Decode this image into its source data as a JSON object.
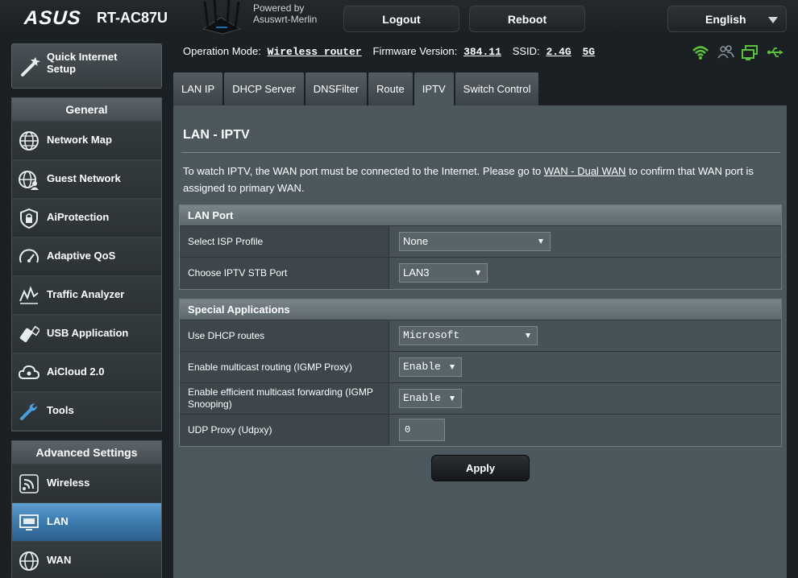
{
  "header": {
    "brand": "ASUS",
    "model": "RT-AC87U",
    "powered_by_line1": "Powered by",
    "powered_by_line2": "Asuswrt-Merlin",
    "logout_label": "Logout",
    "reboot_label": "Reboot",
    "language": "English"
  },
  "status": {
    "operation_mode_label": "Operation Mode:",
    "operation_mode_value": "Wireless router",
    "firmware_label": "Firmware Version:",
    "firmware_value": "384.11",
    "ssid_label": "SSID:",
    "ssid_24": "2.4G",
    "ssid_5": "5G",
    "icons": [
      "wifi-icon",
      "users-icon",
      "network-icon",
      "usb-icon"
    ]
  },
  "sidebar": {
    "quick_setup_line1": "Quick Internet",
    "quick_setup_line2": "Setup",
    "general_title": "General",
    "general_items": [
      {
        "label": "Network Map"
      },
      {
        "label": "Guest Network"
      },
      {
        "label": "AiProtection"
      },
      {
        "label": "Adaptive QoS"
      },
      {
        "label": "Traffic Analyzer"
      },
      {
        "label": "USB Application"
      },
      {
        "label": "AiCloud 2.0"
      },
      {
        "label": "Tools"
      }
    ],
    "advanced_title": "Advanced Settings",
    "advanced_items": [
      {
        "label": "Wireless"
      },
      {
        "label": "LAN"
      },
      {
        "label": "WAN"
      }
    ]
  },
  "tabs": [
    {
      "label": "LAN IP"
    },
    {
      "label": "DHCP Server"
    },
    {
      "label": "DNSFilter"
    },
    {
      "label": "Route"
    },
    {
      "label": "IPTV"
    },
    {
      "label": "Switch Control"
    }
  ],
  "page": {
    "title": "LAN - IPTV",
    "desc_before": "To watch IPTV, the WAN port must be connected to the Internet. Please go to ",
    "desc_link": "WAN - Dual WAN",
    "desc_after": " to confirm that WAN port is assigned to primary WAN."
  },
  "lan_port": {
    "title": "LAN Port",
    "isp_profile_label": "Select ISP Profile",
    "isp_profile_value": "None",
    "stb_port_label": "Choose IPTV STB Port",
    "stb_port_value": "LAN3"
  },
  "special_apps": {
    "title": "Special Applications",
    "dhcp_routes_label": "Use DHCP routes",
    "dhcp_routes_value": "Microsoft",
    "igmp_proxy_label": "Enable multicast routing (IGMP Proxy)",
    "igmp_proxy_value": "Enable",
    "igmp_snooping_label": "Enable efficient multicast forwarding (IGMP Snooping)",
    "igmp_snooping_value": "Enable",
    "udpxy_label": "UDP Proxy (Udpxy)",
    "udpxy_value": "0"
  },
  "apply_label": "Apply"
}
